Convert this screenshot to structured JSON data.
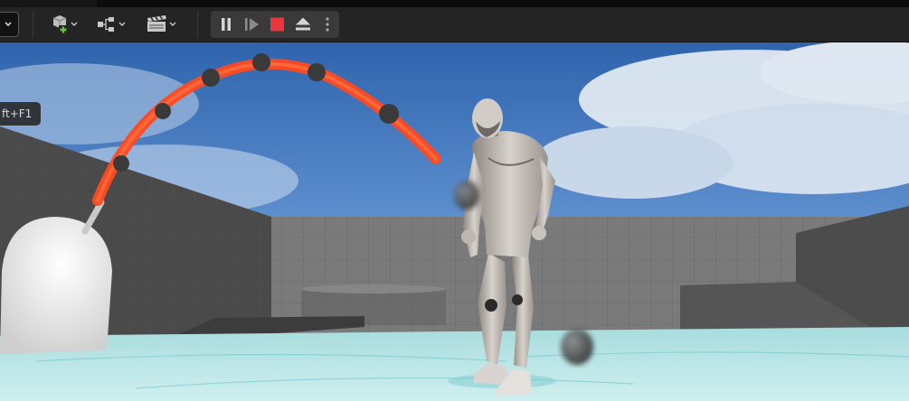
{
  "toolbar": {
    "items": [
      {
        "name": "mode-selector",
        "icon": "mode-dropdown-icon"
      },
      {
        "name": "add-actor-button",
        "icon": "cube-plus-icon"
      },
      {
        "name": "blueprints-button",
        "icon": "blueprint-graph-icon"
      },
      {
        "name": "cinematics-button",
        "icon": "clapperboard-icon"
      }
    ],
    "play_controls": [
      {
        "name": "pause-button",
        "icon": "pause-icon"
      },
      {
        "name": "step-frame-button",
        "icon": "step-forward-icon"
      },
      {
        "name": "stop-button",
        "icon": "stop-icon",
        "color": "#e8383d"
      },
      {
        "name": "eject-button",
        "icon": "eject-icon"
      },
      {
        "name": "more-options-button",
        "icon": "vertical-ellipsis-icon"
      }
    ]
  },
  "viewport": {
    "shortcut_hint": "ft+F1",
    "scene": {
      "sky_color": "#3b6fb0",
      "floor_color": "#bfe8e8",
      "trajectory_color": "#ff3a1a"
    }
  }
}
